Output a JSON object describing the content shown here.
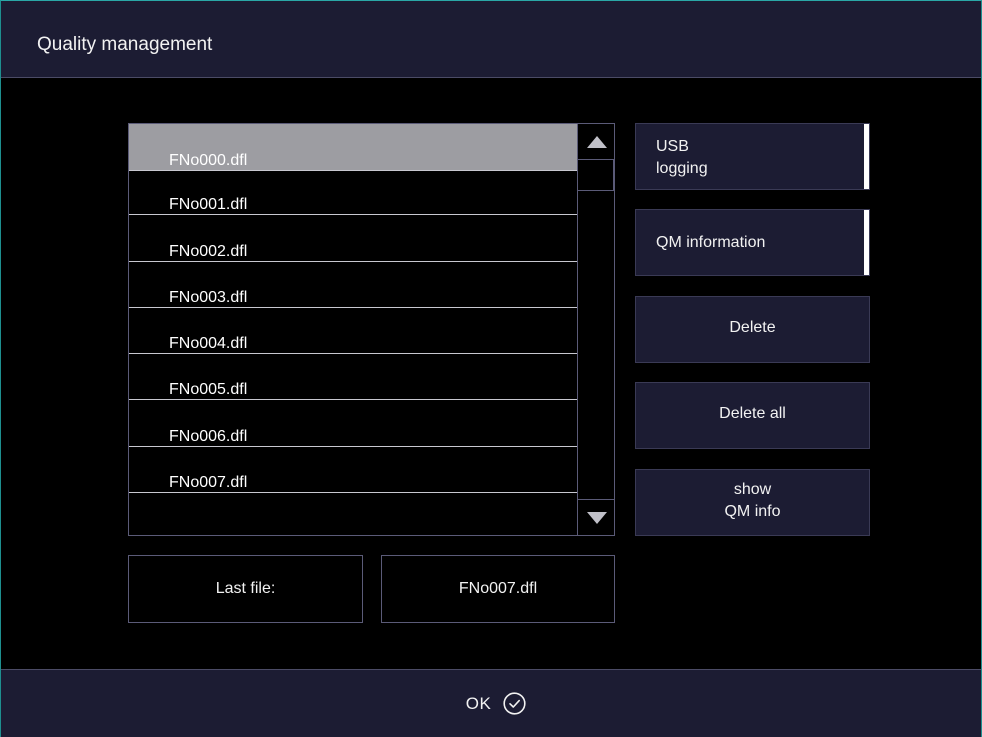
{
  "header": {
    "title": "Quality management"
  },
  "file_list": {
    "items": [
      "FNo000.dfl",
      "FNo001.dfl",
      "FNo002.dfl",
      "FNo003.dfl",
      "FNo004.dfl",
      "FNo005.dfl",
      "FNo006.dfl",
      "FNo007.dfl"
    ],
    "selected_index": 0
  },
  "scrollbar": {
    "up_icon": "triangle-up-icon",
    "down_icon": "triangle-down-icon"
  },
  "buttons": {
    "usb_logging": "USB\nlogging",
    "qm_information": "QM information",
    "delete": "Delete",
    "delete_all": "Delete all",
    "show_qm_info": "show\nQM info"
  },
  "last_file": {
    "label": "Last file:",
    "value": "FNo007.dfl"
  },
  "footer": {
    "ok_label": "OK",
    "ok_icon": "check-circle-icon"
  },
  "colors": {
    "bar_background": "#1c1c33",
    "selected_row": "#9d9da2",
    "frame_accent": "#1e8f8f"
  }
}
